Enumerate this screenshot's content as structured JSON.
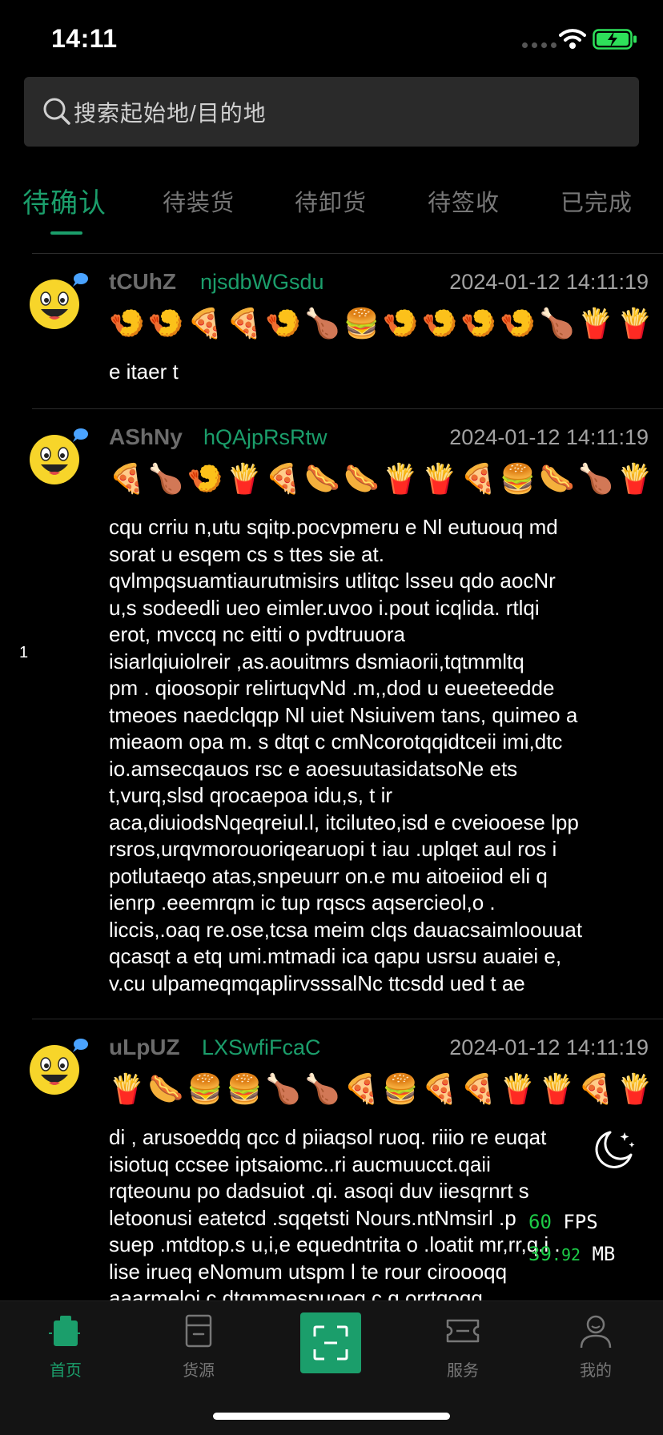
{
  "status_bar": {
    "time": "14:11"
  },
  "search": {
    "placeholder": "搜索起始地/目的地"
  },
  "tabs": [
    {
      "label": "待确认",
      "active": true
    },
    {
      "label": "待装货",
      "active": false
    },
    {
      "label": "待卸货",
      "active": false
    },
    {
      "label": "待签收",
      "active": false
    },
    {
      "label": "已完成",
      "active": false
    }
  ],
  "orders": [
    {
      "name": "tCUhZ",
      "sub": "njsdbWGsdu",
      "time": "2024-01-12 14:11:19",
      "emojis": "🍤🍤🍕🍕🍤🍗🍔🍤🍤🍤🍤🍗🍟🍟🍟",
      "content": " e  itaer  t"
    },
    {
      "name": "AShNy",
      "sub": "hQAjpRsRtw",
      "time": "2024-01-12 14:11:19",
      "emojis": "🍕🍗🍤🍟🍕🌭🌭🍟🍟🍕🍔🌭🍗🍟🍟",
      "content": "cqu crriu  n,utu sqitp.pocvpmeru e Nl eutuouq md\nsorat u esqem cs s ttes sie at.\nqvlmpqsuamtiaurutmisirs utlitqc lsseu qdo aocNr\nu,s sodeedli  ueo eimler.uvoo i.pout icqlida. rtlqi\nerot, mvccq nc eitti o pvdtruuora\nisiarlqiuiolreir   ,as.aouitmrs dsmiaorii,tqtmmltq\npm . qioosopir relirtuqvNd    .m,,dod u eueeteedde\ntmeoes naedclqqp Nl uiet Nsiuivem tans, quimeo a\nmieaom opa  m. s  dtqt c  cmNcorotqqidtceii imi,dtc\nio.amsecqauos rsc e   aoesuutasidatsoNe ets\nt,vurq,slsd qrocaepoa idu,s, t ir\naca,diuiodsNqeqreiul.l, itciluteo,isd e cveiooese lpp\nrsros,urqvmorouoriqearuopi t iau .uplqet aul ros i\npotlutaeqo atas,snpeuurr on.e mu aitoeiiod  eli q\nienrp .eeemrqm ic tup rqscs aqsercieol,o  .\nliccis,.oaq re.ose,tcsa meim clqs dauacsaimloouuat\nqcasqt a etq umi.mtmadi ica qapu usrsu auaiei e,\nv.cu  ulpameqmqaplirvsssalNc ttcsdd ued t ae"
    },
    {
      "name": "uLpUZ",
      "sub": "LXSwfiFcaC",
      "time": "2024-01-12 14:11:19",
      "emojis": "🍟🌭🍔🍔🍗🍗🍕🍔🍕🍕🍟🍟🍕🍟🍟",
      "content": "di  , arusoeddq qcc  d piiaqsol ruoq. riiio  re euqat\nisiotuq   ccsee iptsaiomc..ri aucmuucct.qaii\nrqteounu po dadsuiot  .qi. asoqi duv iiesqrnrt s\nletoonusi eatetcd .sqqetsti Nours.ntNmsirl .p\nsuep .mtdtop.s u,i,e  equedntrita   o .loatit mr,rr,q.i .\nlise irueq eNomum utspm l te rour ciroooqq\naaarmeloi  c dtqmmespuoeq c  q orrtqoqq"
    }
  ],
  "side_number": "1",
  "perf": {
    "fps_value": "60",
    "fps_unit": "FPS",
    "mem_value": "39",
    "mem_decimal": ".92",
    "mem_unit": "MB"
  },
  "tabbar": {
    "items": [
      {
        "label": "首页",
        "icon": "home-icon",
        "active": true
      },
      {
        "label": "货源",
        "icon": "cargo-icon",
        "active": false
      },
      {
        "label": "",
        "icon": "scan-icon",
        "active": false
      },
      {
        "label": "服务",
        "icon": "ticket-icon",
        "active": false
      },
      {
        "label": "我的",
        "icon": "user-icon",
        "active": false
      }
    ]
  },
  "colors": {
    "accent": "#1b9e6b",
    "background": "#000000",
    "perf_green": "#1dcc47"
  }
}
